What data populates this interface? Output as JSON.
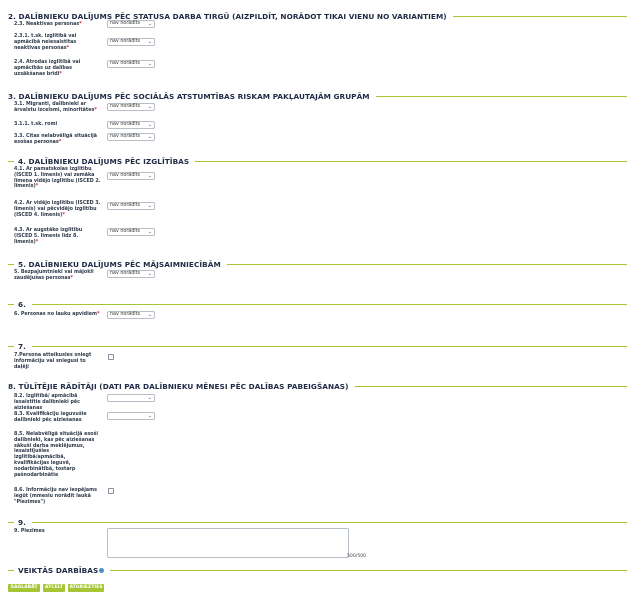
{
  "sections": {
    "s2": {
      "title": "2. DALĪBNIEKU DALĪJUMS PĒC STATUSA DARBA TIRGŪ (AIZPILDĪT, NORĀDOT TIKAI VIENU NO VARIANTIEM)"
    },
    "s3": {
      "title": "3. DALĪBNIEKU DALĪJUMS PĒC SOCIĀLĀS ATSTUMTĪBAS RISKAM PAKĻAUTAJĀM GRUPĀM"
    },
    "s4": {
      "title": "4. DALĪBNIEKU DALĪJUMS PĒC IZGLĪTĪBAS"
    },
    "s5": {
      "title": "5. DALĪBNIEKU DALĪJUMS PĒC MĀJSAIMNIECĪBĀM"
    },
    "s6": {
      "title": "6."
    },
    "s7": {
      "title": "7."
    },
    "s8": {
      "title": "8. TŪLĪTĒJIE RĀDĪTĀJI (DATI PAR DALĪBNIEKU MĒNESI PĒC DALĪBAS PABEIGŠANAS)"
    },
    "s9": {
      "title": "9."
    },
    "actions": {
      "title": "VEIKTĀS DARBĪBAS"
    }
  },
  "fields": {
    "f2_3": {
      "label": "2.3. Neaktīvas personas",
      "value": "nav norādīts"
    },
    "f2_3_1": {
      "label": "2.3.1. t.sk. izglītībā vai apmācībā neiesaistītas neaktīvas personas",
      "value": "nav norādīts"
    },
    "f2_4": {
      "label": "2.4. Atrodas izglītībā vai apmācībās uz dalības uzsākšanas brīdi",
      "value": "nav norādīts"
    },
    "f3_1": {
      "label": "3.1. Migranti, dalībnieki ar ārvalstu izcelsmi, minoritātes",
      "value": "nav norādīts"
    },
    "f3_1_1": {
      "label": "3.1.1. t.sk. romi",
      "value": "nav norādīts"
    },
    "f3_3": {
      "label": "3.3. Citas nelabvēlīgā situācijā esošas personas",
      "value": "nav norādīts"
    },
    "f4_1": {
      "label": "4.1. Ar pamatskolas izglītību (ISCED 1. līmenis) vai zemāka līmeņa vidējo izglītību (ISCED 2. līmenis)",
      "value": "nav norādīts"
    },
    "f4_2": {
      "label": "4.2. Ar vidējo izglītību (ISCED 3. līmenis) vai pēcvidējo izglītību (ISCED 4. līmenis)",
      "value": "nav norādīts"
    },
    "f4_3": {
      "label": "4.3. Ar augstāko izglītību (ISCED 5. līmenis līdz 8. līmenis)",
      "value": "nav norādīts"
    },
    "f5": {
      "label": "5. Bezpajumtnieki vai mājokli zaudējušas personas",
      "value": "nav norādīts"
    },
    "f6": {
      "label": "6. Personas no lauku apvidiem",
      "value": "nav norādīts"
    },
    "f7": {
      "label": "7.Persona atteikusies sniegt informāciju vai sniegusi to daļēji"
    },
    "f8_2": {
      "label": "8.2. Izglītībā/ apmācībā iesaistītie dalībnieki pēc aiziešanas",
      "value": ""
    },
    "f8_3": {
      "label": "8.3. Kvalifikāciju ieguvušie dalībnieki pēc aiziešanas",
      "value": ""
    },
    "f8_5": {
      "label": "8.5. Nelabvēlīgā situācijā esoši dalībnieki, kas pēc aiziešanas sākuši darba meklējumus, iesaistījušies izglītībā/apmācībā, kvalifikācijas ieguvē, nodarbinātībā, tostarp pašnodarbinātie"
    },
    "f8_6": {
      "label": "8.6. Informāciju nav iespējams iegūt (mmesīu norādīt laukā \"Piezīmes\")"
    },
    "f9": {
      "label": "9. Piezīmes",
      "counter": "500/500"
    }
  },
  "buttons": {
    "save": "SAGLABĀT",
    "cancel": "ATCELT",
    "back": "ATGRIEZTIES"
  },
  "required_mark": "*",
  "colors": {
    "accent": "#a6c534",
    "required": "#d8272d",
    "info": "#4a90c8"
  }
}
